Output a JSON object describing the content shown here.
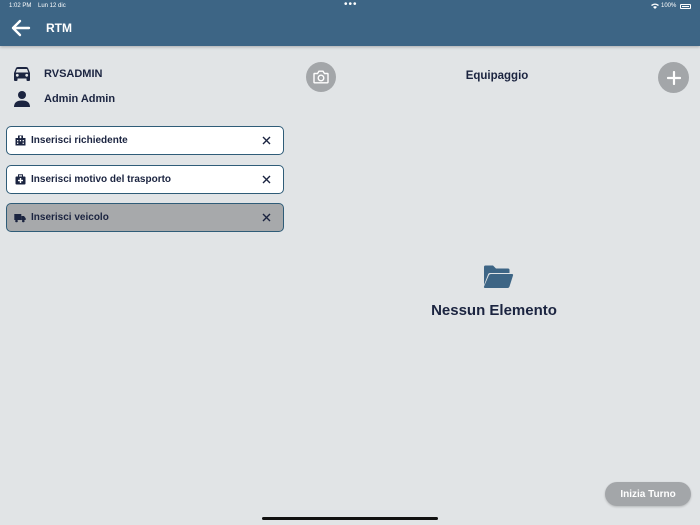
{
  "status_bar": {
    "time": "1:02 PM",
    "date": "Lun 12 dic",
    "battery": "100%"
  },
  "header": {
    "title": "RTM",
    "back_icon": "arrow-left-icon"
  },
  "user_info": {
    "vehicle_user": "RVSADMIN",
    "person_name": "Admin Admin"
  },
  "fields": [
    {
      "label": "Inserisci richiedente",
      "icon": "hospital-icon",
      "disabled": false
    },
    {
      "label": "Inserisci motivo del trasporto",
      "icon": "medical-case-icon",
      "disabled": false
    },
    {
      "label": "Inserisci veicolo",
      "icon": "truck-icon",
      "disabled": true
    }
  ],
  "crew_panel": {
    "title": "Equipaggio",
    "empty_text": "Nessun Elemento"
  },
  "footer": {
    "start_button": "Inizia Turno"
  },
  "colors": {
    "header_bg": "#3d6585",
    "page_bg": "#e1e4e6",
    "text_dark": "#1b2440",
    "accent": "#2f5c78",
    "button_grey": "#a3a6a9"
  }
}
